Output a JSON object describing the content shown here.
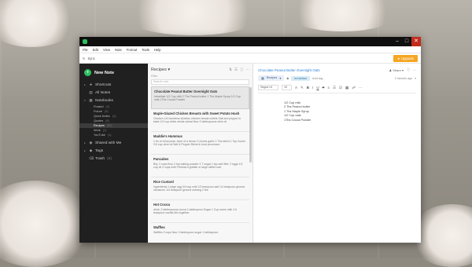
{
  "menu": [
    "File",
    "Edit",
    "View",
    "Note",
    "Format",
    "Tools",
    "Help"
  ],
  "sync_label": "Sync",
  "upgrade_label": "Upgrade",
  "sidebar": {
    "new_note": "New Note",
    "shortcuts": "Shortcuts",
    "all_notes": "All Notes",
    "notebooks": "Notebooks",
    "notebook_items": [
      {
        "label": "Fixated",
        "count": "(3)"
      },
      {
        "label": "Future",
        "count": "(9)"
      },
      {
        "label": "Quick Notes",
        "count": "(1)"
      },
      {
        "label": "Quotes",
        "count": "(8)"
      },
      {
        "label": "Recipes",
        "count": "(20)"
      },
      {
        "label": "Work",
        "count": "(1)"
      },
      {
        "label": "YouTube",
        "count": "(1)"
      }
    ],
    "shared": "Shared with Me",
    "tags": "Tags",
    "trash": "Trash",
    "trash_count": "(5)"
  },
  "list": {
    "title": "Recipes",
    "filter": "Filter",
    "search_placeholder": "Search note",
    "notes": [
      {
        "title": "Chocolate Peanut Butter Overnight Oats",
        "snippet": "breakfast 1/2 Cup milk 2 Tbs Peanut butter 1 Tbs Maple Syrup 1/2 Cup oats 1Tbs Cocoa Powder",
        "date": ""
      },
      {
        "title": "Maple-Glazed Chicken Breasts with Sweet Potato Hash",
        "snippet": "Chicken 1/4 boneless skinless chicken breast cutlets Salt and pepper to taste 1/2 cup white whole-wheat flour 2 tablespoons olive oil",
        "date": ""
      },
      {
        "title": "Maddie's Hummus",
        "snippet": "1 tin of chick peas Juice of a lemon 2 cloves garlic 1 Tbs tahini 1 Tsp Cumin 2/4 cup olive oil Salt & Pepper Blend in food processor",
        "date": ""
      },
      {
        "title": "Pancakes",
        "snippet": "Bnj: 2 cups flour 2 tsp baking powder 4 T sugar 1 tsp salt Wet: 2 eggs 1/2 cup oil 2 cups milk Preheat a griddle or large skillet over",
        "date": ""
      },
      {
        "title": "Rice Custard",
        "snippet": "Ingredients 1 large egg 3/4 cup milk 1/3 teaspoon salt 1/4 teaspoon ground cinnamon 1/4 teaspoon ground nutmeg 2 tbs",
        "date": ""
      },
      {
        "title": "Hot Cocoa",
        "snippet": "drink: 2 tablespoons cocoa 1 tablespoon Sugar 1 Cup warm milk 1/4 teaspoon vanilla Mix together.",
        "date": ""
      },
      {
        "title": "Waffles",
        "snippet": "Waffles 2 cups flour 2 tablespoon sugar 1 tablespoon",
        "date": ""
      }
    ]
  },
  "editor": {
    "title": "Chocolate Peanut Butter Overnight Oats",
    "share": "Share",
    "notebook_chip": "Recipes",
    "tag_chip": "breakfast",
    "add_tag": "Add tag...",
    "meta": "2 minutes ago",
    "font": "Segoe UI",
    "size": "10",
    "lines": [
      "1/2 Cup milk",
      "2 Tbs Peanut butter",
      "1 Tbs Maple Syrup",
      "1/2 Cup oats",
      "1Tbs Cocoa Powder"
    ]
  }
}
